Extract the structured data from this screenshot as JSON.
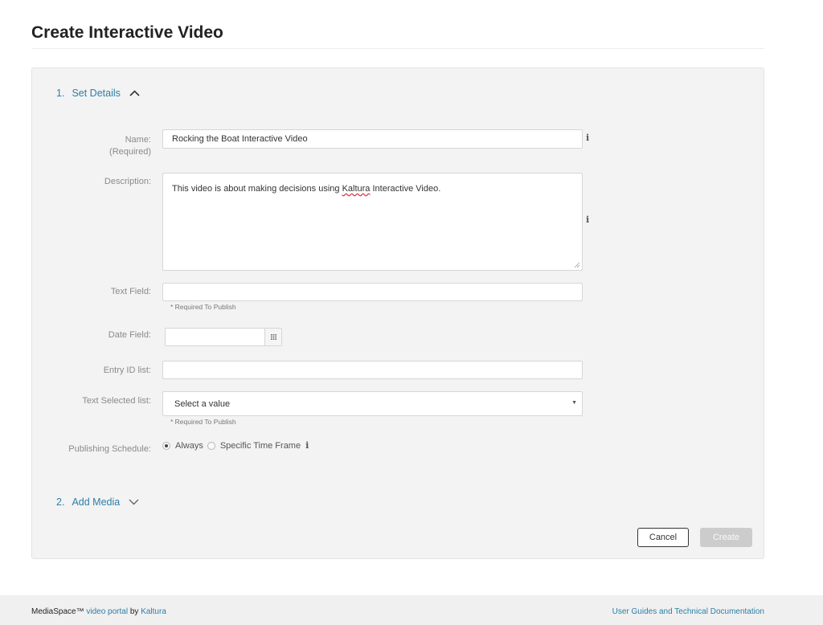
{
  "page": {
    "title": "Create Interactive Video"
  },
  "sections": [
    {
      "number": "1.",
      "label": "Set Details",
      "state": "expanded",
      "chevron_icon": "chevron-up-icon"
    },
    {
      "number": "2.",
      "label": "Add Media",
      "state": "collapsed",
      "chevron_icon": "chevron-down-icon"
    }
  ],
  "form": {
    "name": {
      "label": "Name:",
      "sublabel": "(Required)",
      "value": "Rocking the Boat Interactive Video"
    },
    "description": {
      "label": "Description:",
      "value_prefix": "This video is about making decisions using ",
      "value_misspelled": "Kaltura",
      "value_suffix": " Interactive Video."
    },
    "text_field": {
      "label": "Text Field:",
      "value": "",
      "hint": "* Required To Publish"
    },
    "date_field": {
      "label": "Date Field:",
      "value": "",
      "button_icon": "calendar-icon"
    },
    "entry_id_list": {
      "label": "Entry ID list:",
      "value": ""
    },
    "text_selected_list": {
      "label": "Text Selected list:",
      "selected": "Select a value",
      "hint": "* Required To Publish"
    },
    "publishing_schedule": {
      "label": "Publishing Schedule:",
      "options": [
        {
          "label": "Always",
          "checked": true
        },
        {
          "label": "Specific Time Frame",
          "checked": false
        }
      ]
    },
    "info_icon": "i"
  },
  "actions": {
    "cancel": "Cancel",
    "create": "Create"
  },
  "footer": {
    "brand": "MediaSpace™",
    "link1": "video portal",
    "by": "by",
    "link2": "Kaltura",
    "right_link": "User Guides and Technical Documentation"
  },
  "colors": {
    "accent": "#2b7fa6",
    "panel_bg": "#f3f3f3",
    "disabled_button": "#cccccc"
  }
}
